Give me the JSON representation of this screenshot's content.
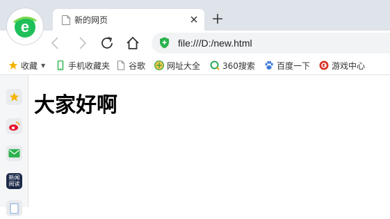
{
  "tab": {
    "title": "新的网页"
  },
  "address": {
    "url": "file:///D:/new.html"
  },
  "bookmarks": [
    {
      "label": "收藏",
      "icon": "star-icon"
    },
    {
      "label": "手机收藏夹",
      "icon": "phone-icon"
    },
    {
      "label": "谷歌",
      "icon": "page-icon"
    },
    {
      "label": "网址大全",
      "icon": "globe-icon"
    },
    {
      "label": "360搜索",
      "icon": "search-360-icon"
    },
    {
      "label": "百度一下",
      "icon": "paw-icon"
    },
    {
      "label": "游戏中心",
      "icon": "game-icon"
    }
  ],
  "sidebar": {
    "news_label": "新闻\n阅读"
  },
  "page": {
    "heading": "大家好啊"
  },
  "colors": {
    "tabstrip": "#dfe3ea",
    "brand_green": "#1fbf5a",
    "shield_green": "#2bb24c",
    "news_badge": "#1c2a4a"
  }
}
